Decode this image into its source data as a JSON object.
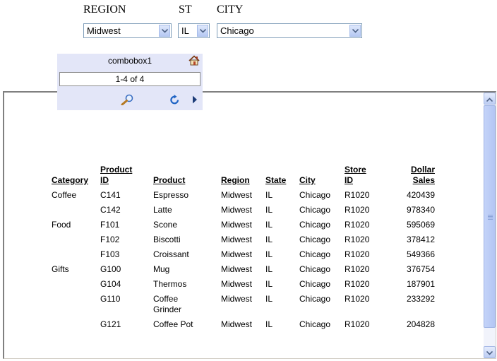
{
  "filters": {
    "region": {
      "label": "REGION",
      "value": "Midwest"
    },
    "st": {
      "label": "ST",
      "value": "IL"
    },
    "city": {
      "label": "CITY",
      "value": "Chicago"
    }
  },
  "combobox": {
    "title": "combobox1",
    "range": "1-4 of 4"
  },
  "report": {
    "headers": {
      "category": "Category",
      "product_id_1": "Product",
      "product_id_2": "ID",
      "product": "Product",
      "region": "Region",
      "state": "State",
      "city": "City",
      "store_id_1": "Store",
      "store_id_2": "ID",
      "sales_1": "Dollar",
      "sales_2": "Sales"
    },
    "rows": [
      {
        "category": "Coffee",
        "id": "C141",
        "product": "Espresso",
        "product2": "",
        "region": "Midwest",
        "state": "IL",
        "city": "Chicago",
        "store": "R1020",
        "sales": "420439"
      },
      {
        "category": "",
        "id": "C142",
        "product": "Latte",
        "product2": "",
        "region": "Midwest",
        "state": "IL",
        "city": "Chicago",
        "store": "R1020",
        "sales": "978340"
      },
      {
        "category": "Food",
        "id": "F101",
        "product": "Scone",
        "product2": "",
        "region": "Midwest",
        "state": "IL",
        "city": "Chicago",
        "store": "R1020",
        "sales": "595069"
      },
      {
        "category": "",
        "id": "F102",
        "product": "Biscotti",
        "product2": "",
        "region": "Midwest",
        "state": "IL",
        "city": "Chicago",
        "store": "R1020",
        "sales": "378412"
      },
      {
        "category": "",
        "id": "F103",
        "product": "Croissant",
        "product2": "",
        "region": "Midwest",
        "state": "IL",
        "city": "Chicago",
        "store": "R1020",
        "sales": "549366"
      },
      {
        "category": "Gifts",
        "id": "G100",
        "product": "Mug",
        "product2": "",
        "region": "Midwest",
        "state": "IL",
        "city": "Chicago",
        "store": "R1020",
        "sales": "376754"
      },
      {
        "category": "",
        "id": "G104",
        "product": "Thermos",
        "product2": "",
        "region": "Midwest",
        "state": "IL",
        "city": "Chicago",
        "store": "R1020",
        "sales": "187901"
      },
      {
        "category": "",
        "id": "G110",
        "product": "Coffee",
        "product2": "Grinder",
        "region": "Midwest",
        "state": "IL",
        "city": "Chicago",
        "store": "R1020",
        "sales": "233292"
      },
      {
        "category": "",
        "id": "G121",
        "product": "Coffee Pot",
        "product2": "",
        "region": "Midwest",
        "state": "IL",
        "city": "Chicago",
        "store": "R1020",
        "sales": "204828"
      }
    ]
  },
  "icons": {
    "home": "home-icon",
    "zoom": "magnifier-icon",
    "refresh": "refresh-icon",
    "next": "next-arrow-icon"
  }
}
